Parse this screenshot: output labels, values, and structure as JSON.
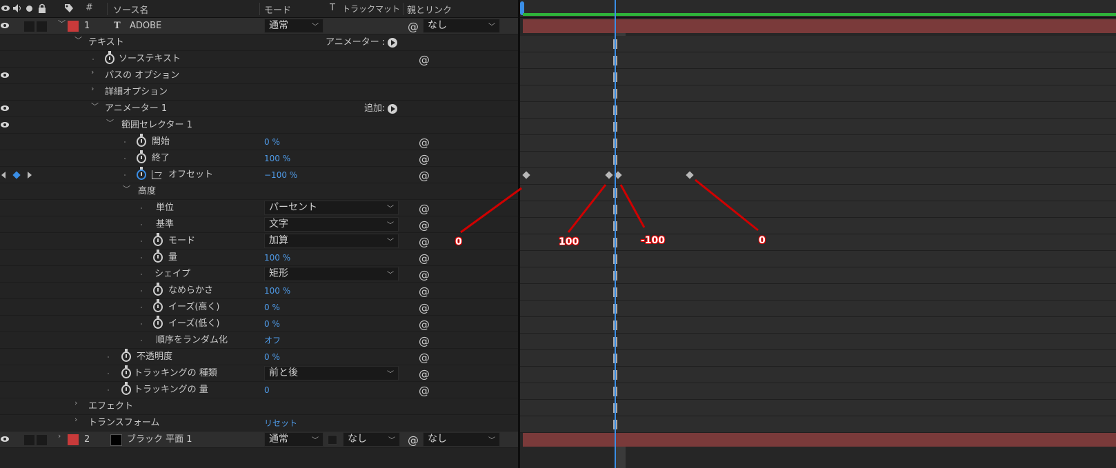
{
  "header": {
    "hash": "#",
    "source_name": "ソース名",
    "mode": "モード",
    "t": "T",
    "track_matte": "トラックマット",
    "parent_link": "親とリンク"
  },
  "layer1": {
    "number": "1",
    "type_glyph": "T",
    "name": "ADOBE",
    "mode": "通常",
    "parent": "なし"
  },
  "props": {
    "text": "テキスト",
    "animator_label": "アニメーター :",
    "source_text": "ソーステキスト",
    "path_options": "パスの オプション",
    "more_options": "詳細オプション",
    "animator1": "アニメーター 1",
    "add_label": "追加:",
    "range_selector": "範囲セレクター 1",
    "start": "開始",
    "start_value": "0 %",
    "end": "終了",
    "end_value": "100 %",
    "offset": "オフセット",
    "offset_value": "−100 %",
    "advanced": "高度",
    "units": "単位",
    "units_value": "パーセント",
    "based_on": "基準",
    "based_on_value": "文字",
    "mode": "モード",
    "mode_value": "加算",
    "amount": "量",
    "amount_value": "100 %",
    "shape": "シェイプ",
    "shape_value": "矩形",
    "smoothness": "なめらかさ",
    "smoothness_value": "100 %",
    "ease_high": "イーズ(高く)",
    "ease_high_value": "0 %",
    "ease_low": "イーズ(低く)",
    "ease_low_value": "0 %",
    "randomize": "順序をランダム化",
    "randomize_value": "オフ",
    "opacity": "不透明度",
    "opacity_value": "0 %",
    "tracking_type": "トラッキングの 種類",
    "tracking_type_value": "前と後",
    "tracking_amount": "トラッキングの 量",
    "tracking_amount_value": "0",
    "effects": "エフェクト",
    "transform": "トランスフォーム",
    "reset": "リセット"
  },
  "layer2": {
    "number": "2",
    "name": "ブラック 平面 1",
    "mode": "通常",
    "matte": "なし",
    "parent": "なし"
  },
  "annotations": [
    "0",
    "100",
    "-100",
    "0"
  ],
  "colors": {
    "label_red": "#c83a3a",
    "value_blue": "#4f9be8",
    "playhead_blue": "#3a8ee6",
    "work_area_green": "#2fb33a",
    "annotation_red": "#e00000"
  }
}
